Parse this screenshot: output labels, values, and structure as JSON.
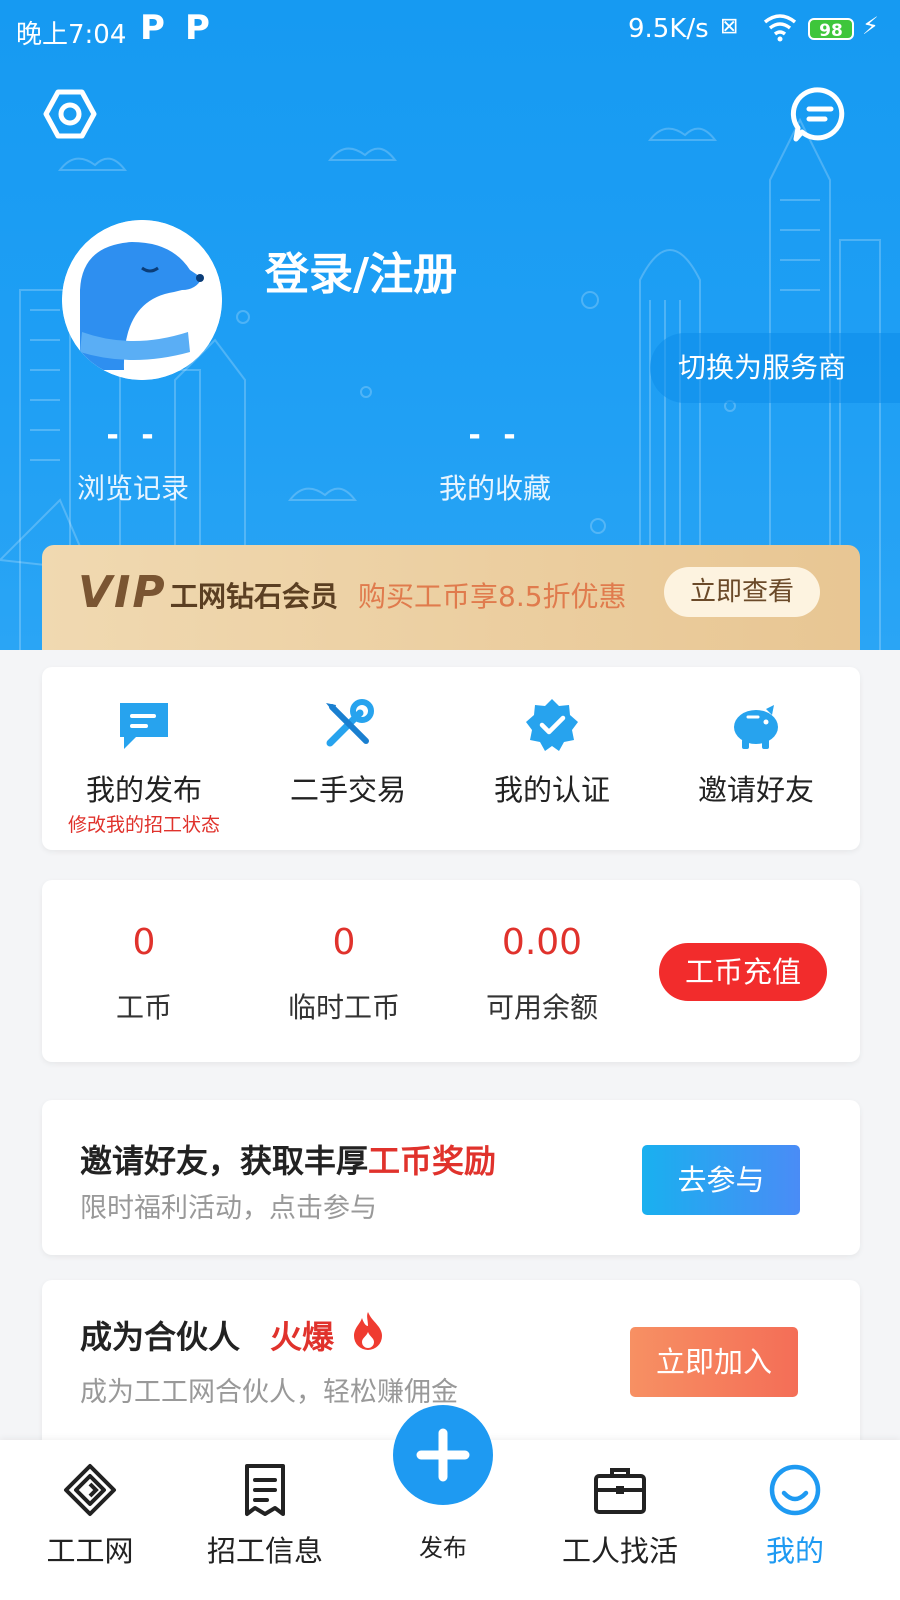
{
  "status_bar": {
    "time": "晚上7:04",
    "notif1": "P",
    "notif2": "P",
    "net_speed": "9.5K/s",
    "battery": "98"
  },
  "header": {
    "login_text": "登录/注册",
    "switch_label": "切换为服务商",
    "stats": [
      {
        "value": "- -",
        "label": "浏览记录"
      },
      {
        "value": "- -",
        "label": "我的收藏"
      }
    ]
  },
  "vip": {
    "logo": "VIP",
    "title": "工网钻石会员",
    "promo": "购买工币享8.5折优惠",
    "button": "立即查看"
  },
  "menu": [
    {
      "label": "我的发布",
      "sub": "修改我的招工状态",
      "icon": "message-square-icon"
    },
    {
      "label": "二手交易",
      "sub": "",
      "icon": "tools-icon"
    },
    {
      "label": "我的认证",
      "sub": "",
      "icon": "verified-badge-icon"
    },
    {
      "label": "邀请好友",
      "sub": "",
      "icon": "piggy-bank-icon"
    }
  ],
  "wallet": {
    "items": [
      {
        "value": "0",
        "label": "工币"
      },
      {
        "value": "0",
        "label": "临时工币"
      },
      {
        "value": "0.00",
        "label": "可用余额"
      }
    ],
    "recharge": "工币充值"
  },
  "invite_card": {
    "title_prefix": "邀请好友，获取丰厚",
    "title_highlight": "工币奖励",
    "subtitle": "限时福利活动，点击参与",
    "button": "去参与"
  },
  "partner_card": {
    "title": "成为合伙人",
    "hot": "火爆",
    "subtitle": "成为工工网合伙人，轻松赚佣金",
    "button": "立即加入"
  },
  "tabbar": {
    "tabs": [
      {
        "label": "工工网",
        "icon": "diamond-logo-icon"
      },
      {
        "label": "招工信息",
        "icon": "document-icon"
      },
      {
        "label": "发布",
        "icon": "plus-icon"
      },
      {
        "label": "工人找活",
        "icon": "briefcase-icon"
      },
      {
        "label": "我的",
        "icon": "smile-icon"
      }
    ],
    "active": "我的"
  },
  "colors": {
    "header_blue": "#1e9af2",
    "accent_red": "#e0322c",
    "vip_gold": "#e8c693"
  }
}
